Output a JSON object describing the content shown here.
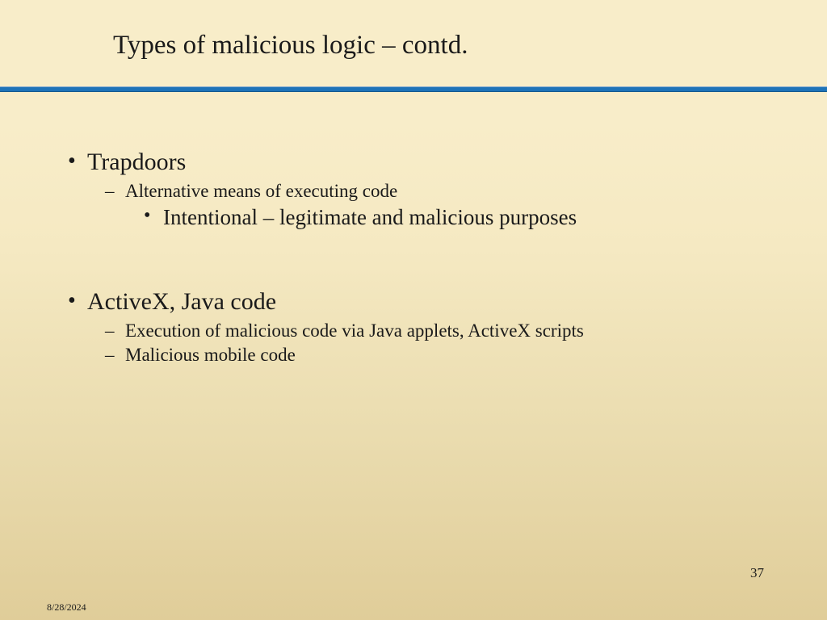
{
  "title": "Types of malicious logic – contd.",
  "sections": [
    {
      "heading": "Trapdoors",
      "items": [
        {
          "text": "Alternative means of executing code",
          "subitems": [
            "Intentional – legitimate and malicious purposes"
          ]
        }
      ]
    },
    {
      "heading": "ActiveX, Java code",
      "items": [
        {
          "text": "Execution of malicious code via Java applets, ActiveX scripts",
          "subitems": []
        },
        {
          "text": "Malicious mobile code",
          "subitems": []
        }
      ]
    }
  ],
  "page_number": "37",
  "date": "8/28/2024"
}
